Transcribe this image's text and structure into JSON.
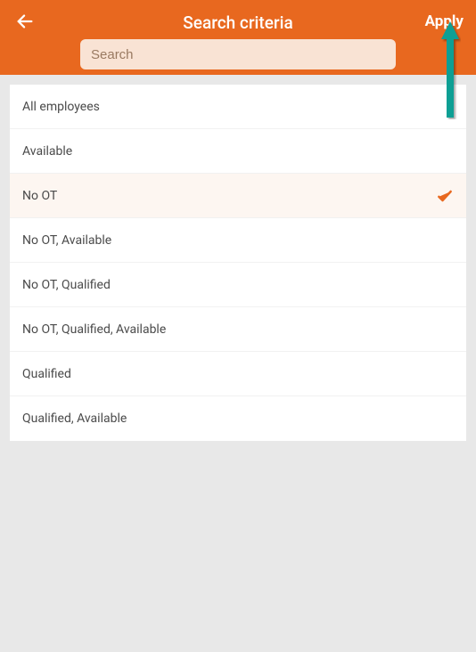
{
  "header": {
    "title": "Search criteria",
    "apply_label": "Apply",
    "back_icon": "back-arrow-icon",
    "search_placeholder": "Search",
    "search_value": ""
  },
  "colors": {
    "accent": "#e8681f",
    "annotation": "#0f9f94"
  },
  "options": [
    {
      "label": "All employees",
      "selected": false
    },
    {
      "label": "Available",
      "selected": false
    },
    {
      "label": "No OT",
      "selected": true
    },
    {
      "label": "No OT, Available",
      "selected": false
    },
    {
      "label": "No OT, Qualified",
      "selected": false
    },
    {
      "label": "No OT, Qualified, Available",
      "selected": false
    },
    {
      "label": "Qualified",
      "selected": false
    },
    {
      "label": "Qualified, Available",
      "selected": false
    }
  ],
  "annotation": {
    "arrow_target": "apply-button"
  }
}
